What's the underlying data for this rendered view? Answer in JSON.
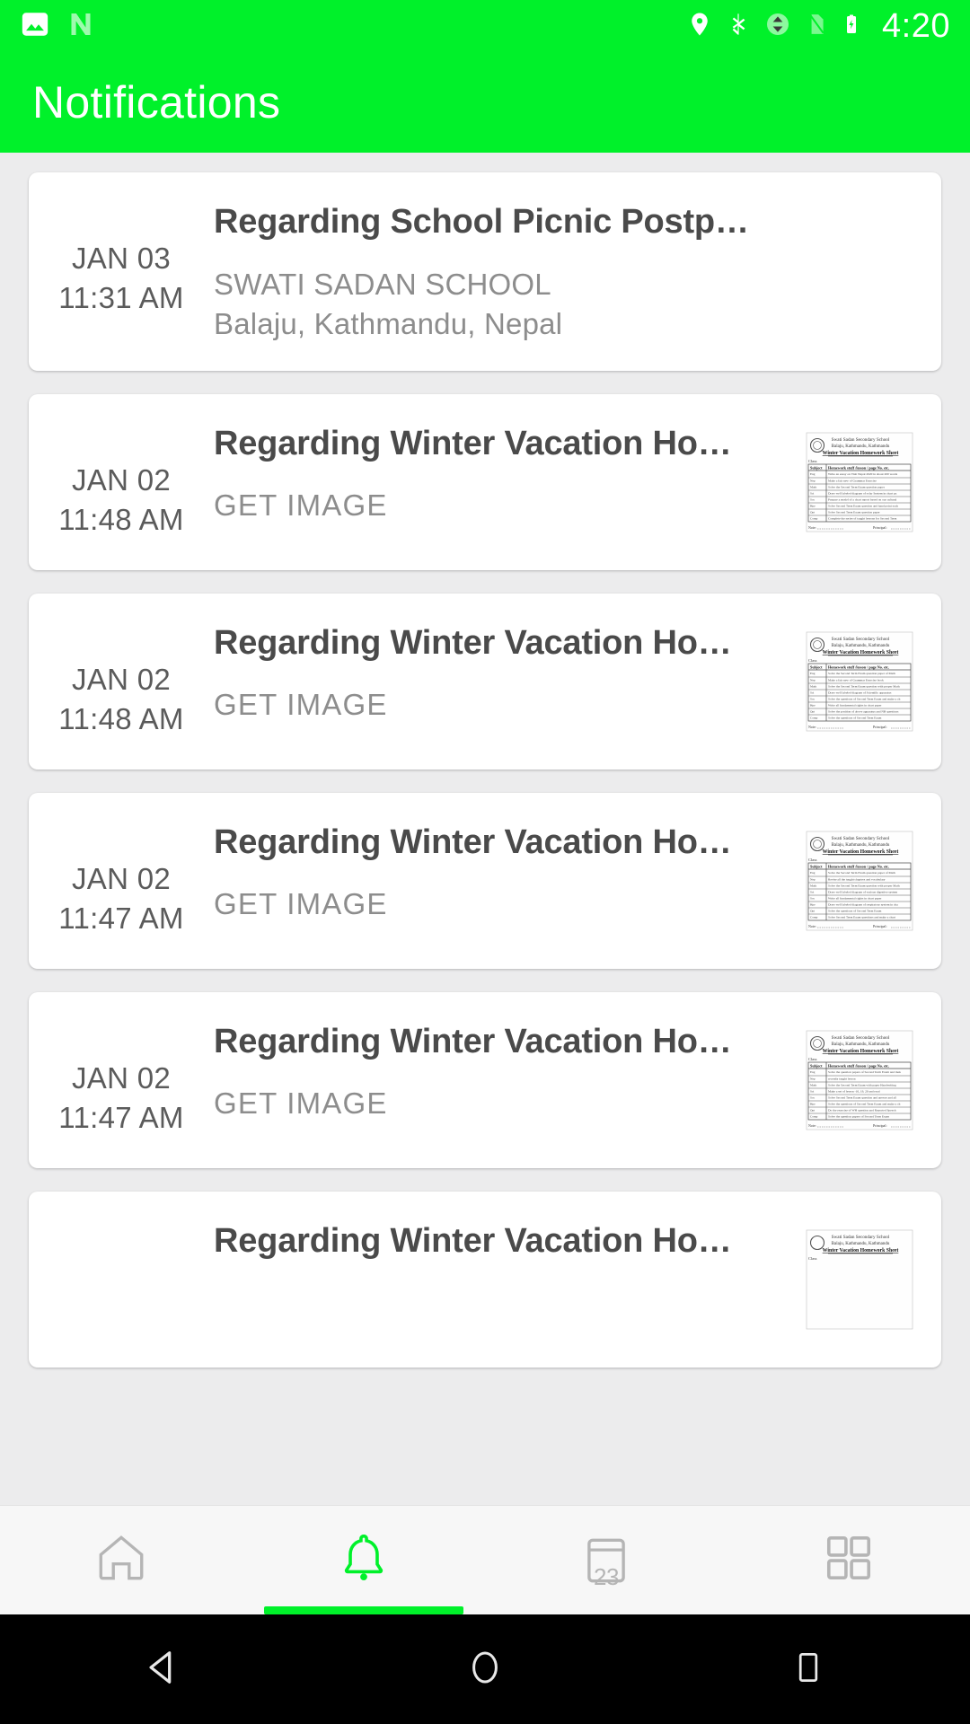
{
  "status_bar": {
    "time": "4:20",
    "left_icons": [
      "photo-icon",
      "nougat-n-icon"
    ],
    "right_icons": [
      "location-icon",
      "bluetooth-icon",
      "sync-icon",
      "sim-icon",
      "battery-charging-icon"
    ],
    "background_color": "#00f12a",
    "foreground_color": "#ffffff"
  },
  "app_bar": {
    "title": "Notifications",
    "background_color": "#00f12a",
    "title_color": "#ffffff"
  },
  "theme": {
    "accent": "#00f12a",
    "page_background": "#ececed",
    "card_background": "#ffffff",
    "title_color": "#4a4a4a",
    "muted_text": "#8d8d8d",
    "date_text": "#5b5b5b"
  },
  "notifications": [
    {
      "date": "JAN 03",
      "time": "11:31 AM",
      "title": "Regarding School Picnic Postp…",
      "sub_lines": [
        "SWATI SADAN SCHOOL",
        "Balaju, Kathmandu, Nepal"
      ],
      "action": null,
      "has_thumbnail": false
    },
    {
      "date": "JAN 02",
      "time": "11:48 AM",
      "title": "Regarding Winter Vacation Ho…",
      "sub_lines": [],
      "action": "GET IMAGE",
      "has_thumbnail": true
    },
    {
      "date": "JAN 02",
      "time": "11:48 AM",
      "title": "Regarding Winter Vacation Ho…",
      "sub_lines": [],
      "action": "GET IMAGE",
      "has_thumbnail": true
    },
    {
      "date": "JAN 02",
      "time": "11:47 AM",
      "title": "Regarding Winter Vacation Ho…",
      "sub_lines": [],
      "action": "GET IMAGE",
      "has_thumbnail": true
    },
    {
      "date": "JAN 02",
      "time": "11:47 AM",
      "title": "Regarding Winter Vacation Ho…",
      "sub_lines": [],
      "action": "GET IMAGE",
      "has_thumbnail": true
    },
    {
      "date": "",
      "time": "",
      "title": "Regarding Winter Vacation Ho…",
      "sub_lines": [],
      "action": null,
      "has_thumbnail": true
    }
  ],
  "thumbnail_document": {
    "school_name": "Swati Sadan Secondary School",
    "address": "Balaju, Kathmandu, Kathmandu",
    "heading": "Winter Vacation Homework Sheet",
    "column_headers": [
      "Subject",
      "Homework stuff /lesson / page No. etc."
    ],
    "footer_left": "Note:",
    "footer_right": "Principal:"
  },
  "tab_bar": {
    "active_index": 1,
    "items": [
      {
        "name": "home",
        "icon": "home-icon",
        "active": false
      },
      {
        "name": "notifications",
        "icon": "bell-icon",
        "active": true
      },
      {
        "name": "calendar",
        "icon": "calendar-icon",
        "badge": "23",
        "active": false
      },
      {
        "name": "more",
        "icon": "grid-icon",
        "active": false
      }
    ],
    "inactive_color": "#b5b5b5",
    "active_color": "#00f12a"
  },
  "nav_bar": {
    "buttons": [
      "back-triangle-icon",
      "home-circle-icon",
      "recents-square-icon"
    ],
    "background_color": "#000000",
    "icon_color": "#e8e8e8"
  }
}
